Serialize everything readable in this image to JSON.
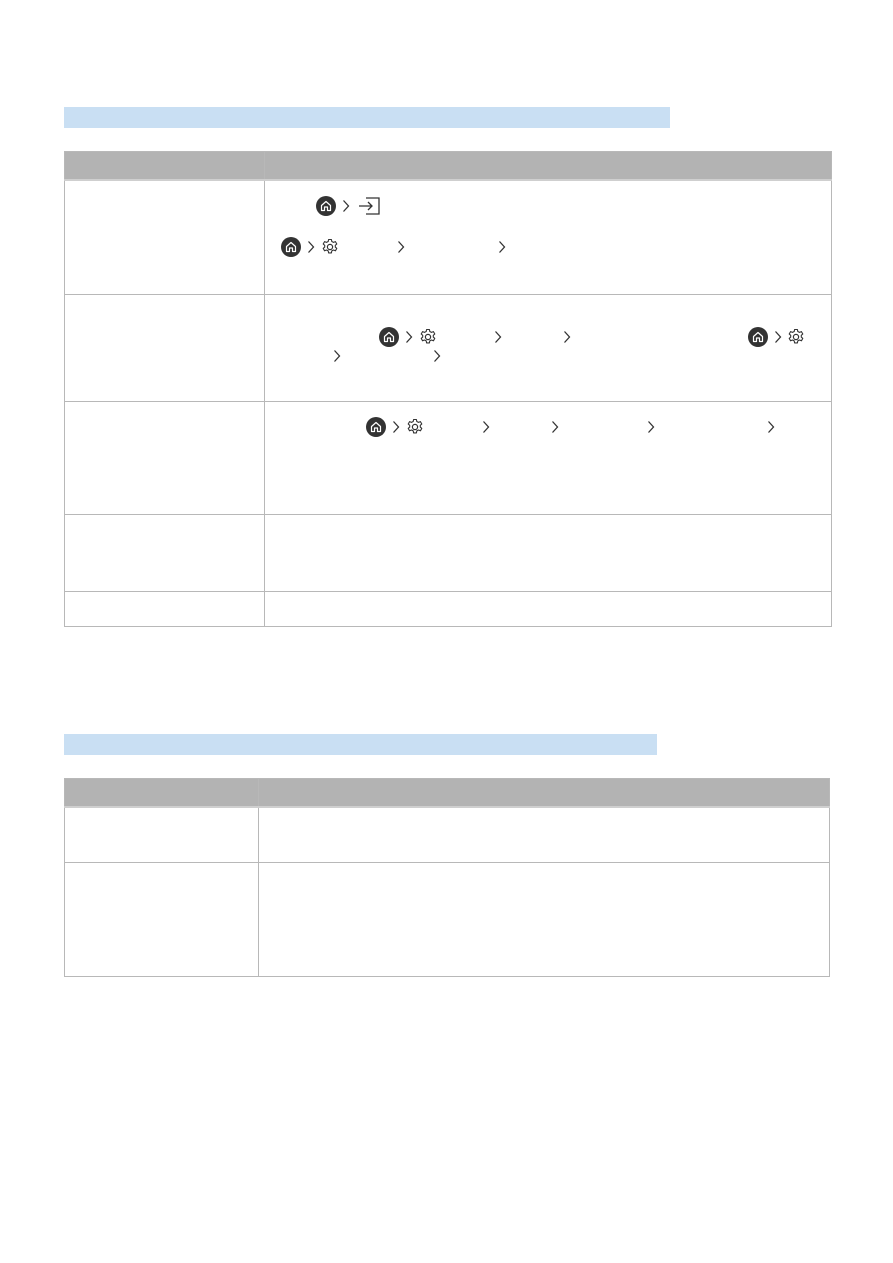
{
  "section1": {
    "title": "",
    "header": {
      "col1": "",
      "col2": ""
    },
    "rows": [
      {
        "problem": "",
        "solution": ""
      },
      {
        "problem": "",
        "solution": ""
      },
      {
        "problem": "",
        "solution": ""
      },
      {
        "problem": "",
        "solution": ""
      },
      {
        "problem": "",
        "solution": ""
      }
    ]
  },
  "section2": {
    "title": "",
    "header": {
      "col1": "",
      "col2": ""
    },
    "rows": [
      {
        "problem": "",
        "solution": ""
      },
      {
        "problem": "",
        "solution": ""
      }
    ]
  },
  "icons": {
    "home": "home-icon",
    "settings": "gear-icon",
    "chevron": "chevron-right-icon",
    "source": "source-input-icon"
  },
  "colors": {
    "section_bar": "#c9dff3",
    "table_header": "#b3b3b3",
    "border": "#b8b8b8",
    "icon_dark": "#333333"
  }
}
